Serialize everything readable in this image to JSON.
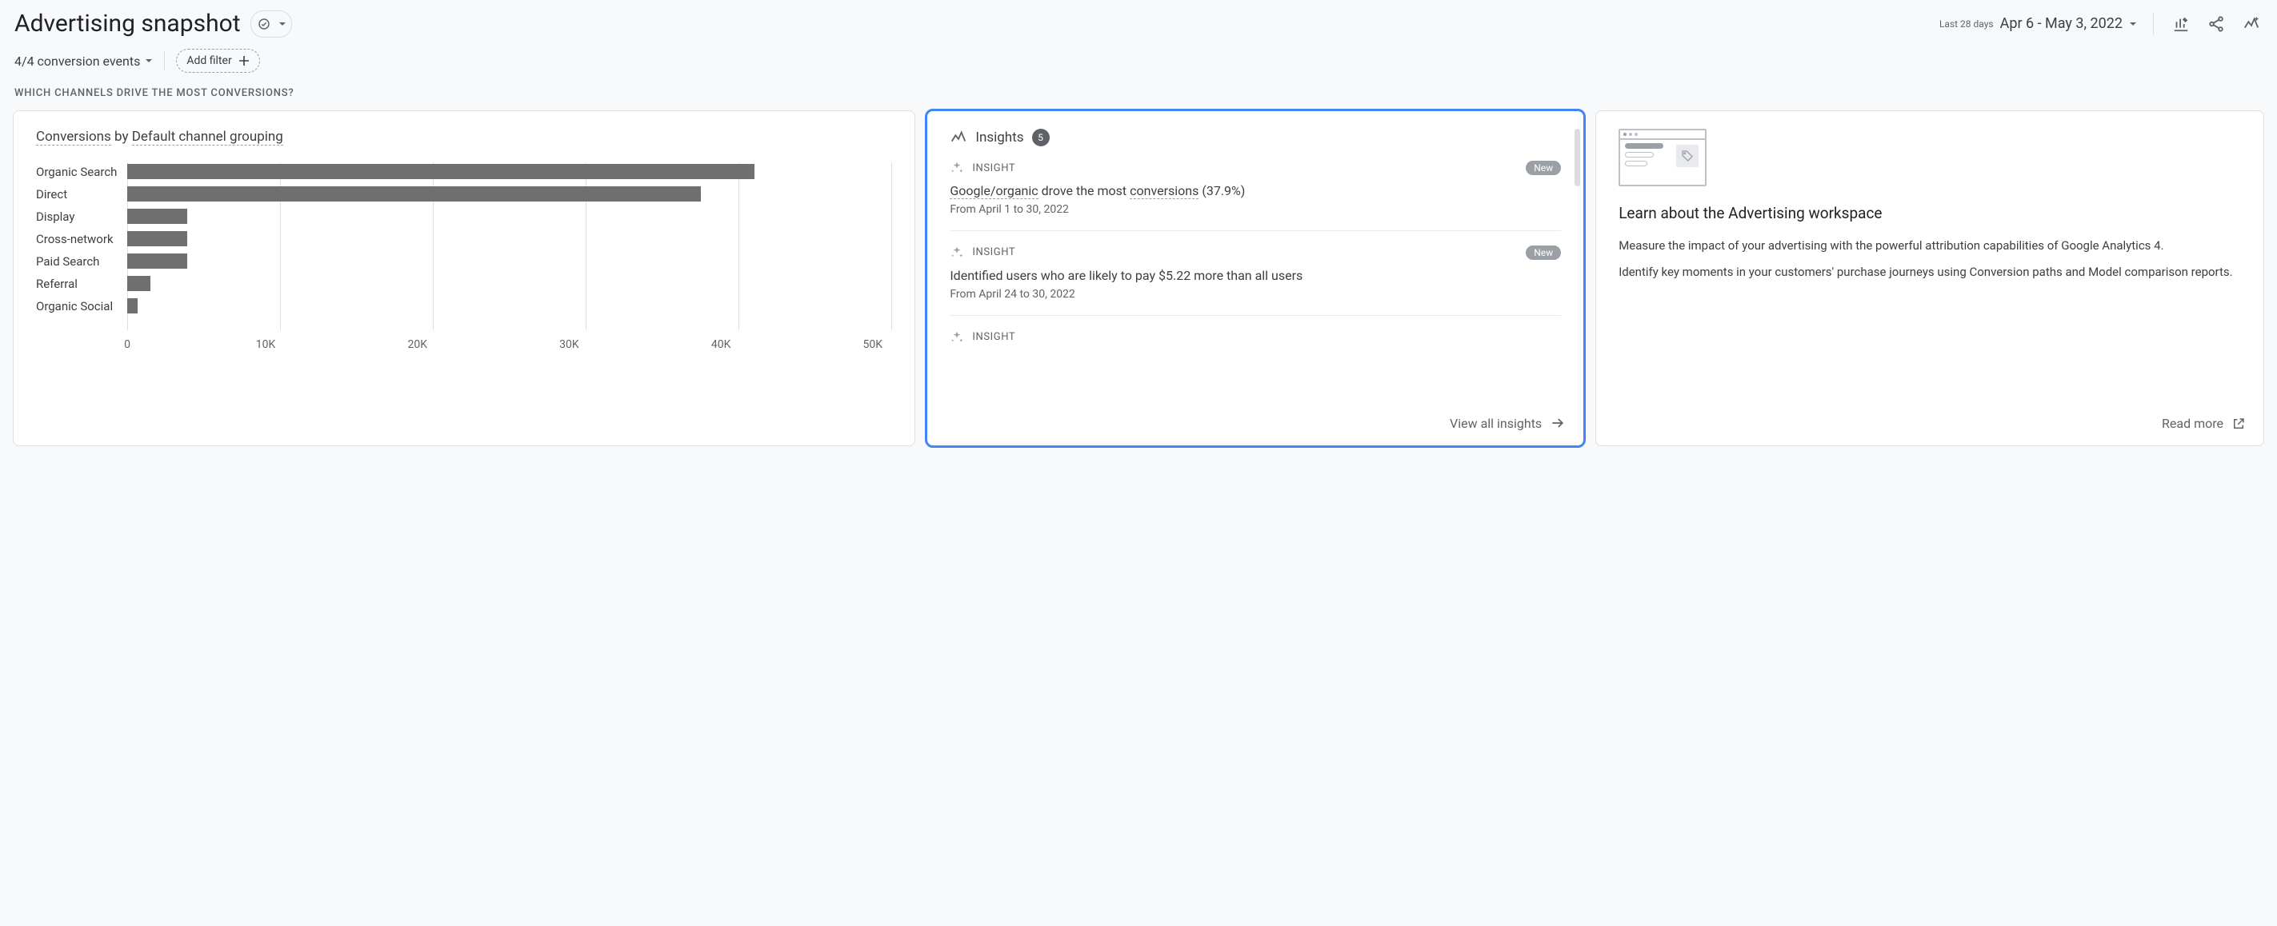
{
  "header": {
    "title": "Advertising snapshot",
    "date_label": "Last 28 days",
    "date_range": "Apr 6 - May 3, 2022"
  },
  "filters": {
    "conversion_label": "4/4 conversion events",
    "add_filter_label": "Add filter"
  },
  "section_question": "WHICH CHANNELS DRIVE THE MOST CONVERSIONS?",
  "conversions_card": {
    "metric": "Conversions",
    "by_text": " by ",
    "dimension": "Default channel grouping"
  },
  "insights_card": {
    "title": "Insights",
    "count": "5",
    "kicker": "INSIGHT",
    "new_label": "New",
    "items": [
      {
        "title_prefix": "Google/organic",
        "title_mid": " drove the most ",
        "title_dotted": "conversions",
        "title_suffix": " (37.9%)",
        "date": "From April 1 to 30, 2022",
        "new": true,
        "dotted_segments": true
      },
      {
        "title_full": "Identified users who are likely to pay $5.22 more than all users",
        "date": "From April 24 to 30, 2022",
        "new": true,
        "dotted_segments": false
      }
    ],
    "view_all": "View all insights"
  },
  "learn_card": {
    "title": "Learn about the Advertising workspace",
    "p1": "Measure the impact of your advertising with the powerful attribution capabilities of Google Analytics 4.",
    "p2": "Identify key moments in your customers' purchase journeys using Conversion paths and Model comparison reports.",
    "read_more": "Read more"
  },
  "chart_data": {
    "type": "bar",
    "title": "Conversions by Default channel grouping",
    "xlabel": "",
    "ylabel": "",
    "xlim": [
      0,
      50000
    ],
    "ticks": [
      "0",
      "10K",
      "20K",
      "30K",
      "40K",
      "50K"
    ],
    "categories": [
      "Organic Search",
      "Direct",
      "Display",
      "Cross-network",
      "Paid Search",
      "Referral",
      "Organic Social"
    ],
    "values": [
      41000,
      37500,
      3900,
      3900,
      3900,
      1500,
      700
    ],
    "color": "#6f6f6f"
  }
}
